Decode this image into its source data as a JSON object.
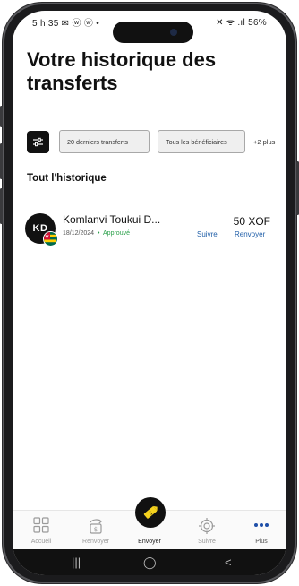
{
  "status_bar": {
    "time_icons": "5 h 35 ✉ ⓦ ⓦ •",
    "system_icons": "✕ ᯤ .ıl 56%"
  },
  "page": {
    "title": "Votre historique des transferts"
  },
  "filters": {
    "chips": [
      "20 derniers transferts",
      "Tous les bénéficiaires"
    ],
    "more": "+2 plus"
  },
  "history": {
    "section_title": "Tout l'historique",
    "transfers": [
      {
        "initials": "KD",
        "name": "Komlanvi Toukui D...",
        "date": "18/12/2024",
        "separator": "•",
        "status": "Approuvé",
        "amount": "50 XOF",
        "track_label": "Suivre",
        "resend_label": "Renvoyer"
      }
    ]
  },
  "bottom_nav": {
    "items": [
      {
        "label": "Accueil",
        "icon": "home-grid-icon"
      },
      {
        "label": "Renvoyer",
        "icon": "resend-money-icon"
      },
      {
        "label": "Envoyer",
        "icon": "send-money-icon"
      },
      {
        "label": "Suivre",
        "icon": "track-target-icon"
      },
      {
        "label": "Plus",
        "icon": "more-dots-icon"
      }
    ]
  },
  "android_nav": {
    "recent": "|||",
    "home": "◯",
    "back": "<"
  },
  "colors": {
    "accent_link": "#1f5ea8",
    "approved": "#2aa04a",
    "fab_accent": "#f5d21e",
    "more_dots": "#1f4fa8"
  }
}
